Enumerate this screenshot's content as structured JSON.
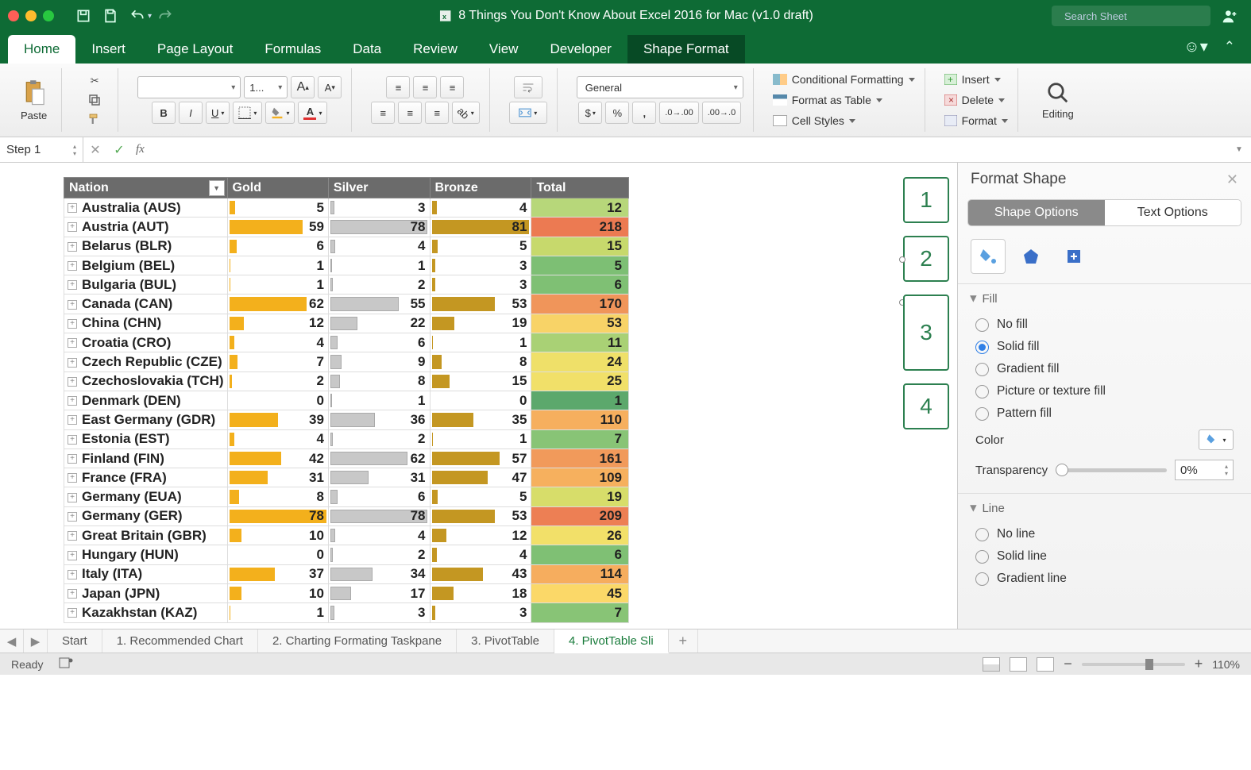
{
  "title": "8 Things You Don't Know About Excel 2016 for Mac (v1.0 draft)",
  "search_placeholder": "Search Sheet",
  "tabs": {
    "home": "Home",
    "insert": "Insert",
    "page_layout": "Page Layout",
    "formulas": "Formulas",
    "data": "Data",
    "review": "Review",
    "view": "View",
    "developer": "Developer",
    "shape_format": "Shape Format"
  },
  "ribbon": {
    "paste": "Paste",
    "editing": "Editing",
    "font_size": "1...",
    "number_format": "General",
    "cond_fmt": "Conditional Formatting",
    "fmt_table": "Format as Table",
    "cell_styles": "Cell Styles",
    "insert": "Insert",
    "delete": "Delete",
    "format": "Format"
  },
  "namebox": "Step 1",
  "headers": {
    "nation": "Nation",
    "gold": "Gold",
    "silver": "Silver",
    "bronze": "Bronze",
    "total": "Total"
  },
  "columns": {
    "nation_w": 167,
    "gold_w": 130,
    "silver_w": 130,
    "bronze_w": 130,
    "total_w": 125
  },
  "max": {
    "gold": 78,
    "silver": 78,
    "bronze": 81
  },
  "rows": [
    {
      "n": "Australia (AUS)",
      "g": 5,
      "s": 3,
      "b": 4,
      "t": 12,
      "c": "#b7d77a"
    },
    {
      "n": "Austria (AUT)",
      "g": 59,
      "s": 78,
      "b": 81,
      "t": 218,
      "c": "#ec7a52"
    },
    {
      "n": "Belarus (BLR)",
      "g": 6,
      "s": 4,
      "b": 5,
      "t": 15,
      "c": "#c7d96c"
    },
    {
      "n": "Belgium (BEL)",
      "g": 1,
      "s": 1,
      "b": 3,
      "t": 5,
      "c": "#7dbf74"
    },
    {
      "n": "Bulgaria (BUL)",
      "g": 1,
      "s": 2,
      "b": 3,
      "t": 6,
      "c": "#7fc074"
    },
    {
      "n": "Canada (CAN)",
      "g": 62,
      "s": 55,
      "b": 53,
      "t": 170,
      "c": "#f0955a"
    },
    {
      "n": "China (CHN)",
      "g": 12,
      "s": 22,
      "b": 19,
      "t": 53,
      "c": "#f8d367"
    },
    {
      "n": "Croatia (CRO)",
      "g": 4,
      "s": 6,
      "b": 1,
      "t": 11,
      "c": "#a9d175"
    },
    {
      "n": "Czech Republic (CZE)",
      "g": 7,
      "s": 9,
      "b": 8,
      "t": 24,
      "c": "#efe069"
    },
    {
      "n": "Czechoslovakia (TCH)",
      "g": 2,
      "s": 8,
      "b": 15,
      "t": 25,
      "c": "#f1e069"
    },
    {
      "n": "Denmark (DEN)",
      "g": 0,
      "s": 1,
      "b": 0,
      "t": 1,
      "c": "#5ca86c"
    },
    {
      "n": "East Germany (GDR)",
      "g": 39,
      "s": 36,
      "b": 35,
      "t": 110,
      "c": "#f6af5e"
    },
    {
      "n": "Estonia (EST)",
      "g": 4,
      "s": 2,
      "b": 1,
      "t": 7,
      "c": "#88c476"
    },
    {
      "n": "Finland (FIN)",
      "g": 42,
      "s": 62,
      "b": 57,
      "t": 161,
      "c": "#f19a5b"
    },
    {
      "n": "France (FRA)",
      "g": 31,
      "s": 31,
      "b": 47,
      "t": 109,
      "c": "#f6b05e"
    },
    {
      "n": "Germany (EUA)",
      "g": 8,
      "s": 6,
      "b": 5,
      "t": 19,
      "c": "#d7dd6a"
    },
    {
      "n": "Germany (GER)",
      "g": 78,
      "s": 78,
      "b": 53,
      "t": 209,
      "c": "#ed7f54"
    },
    {
      "n": "Great Britain (GBR)",
      "g": 10,
      "s": 4,
      "b": 12,
      "t": 26,
      "c": "#f2e069"
    },
    {
      "n": "Hungary (HUN)",
      "g": 0,
      "s": 2,
      "b": 4,
      "t": 6,
      "c": "#7fc074"
    },
    {
      "n": "Italy (ITA)",
      "g": 37,
      "s": 34,
      "b": 43,
      "t": 114,
      "c": "#f6ad5e"
    },
    {
      "n": "Japan (JPN)",
      "g": 10,
      "s": 17,
      "b": 18,
      "t": 45,
      "c": "#fbd868"
    },
    {
      "n": "Kazakhstan (KAZ)",
      "g": 1,
      "s": 3,
      "b": 3,
      "t": 7,
      "c": "#88c476"
    }
  ],
  "slicers": [
    "1",
    "2",
    "3",
    "4"
  ],
  "pane": {
    "title": "Format Shape",
    "shape_opt": "Shape Options",
    "text_opt": "Text Options",
    "fill": "Fill",
    "line": "Line",
    "no_fill": "No fill",
    "solid_fill": "Solid fill",
    "grad_fill": "Gradient fill",
    "pic_fill": "Picture or texture fill",
    "pat_fill": "Pattern fill",
    "color": "Color",
    "transparency": "Transparency",
    "tpct": "0%",
    "no_line": "No line",
    "solid_line": "Solid line",
    "grad_line": "Gradient line"
  },
  "sheets": {
    "s1": "Start",
    "s2": "1. Recommended Chart",
    "s3": "2. Charting Formating Taskpane",
    "s4": "3. PivotTable",
    "s5": "4. PivotTable Sli"
  },
  "status": {
    "ready": "Ready",
    "zoom": "110%"
  }
}
